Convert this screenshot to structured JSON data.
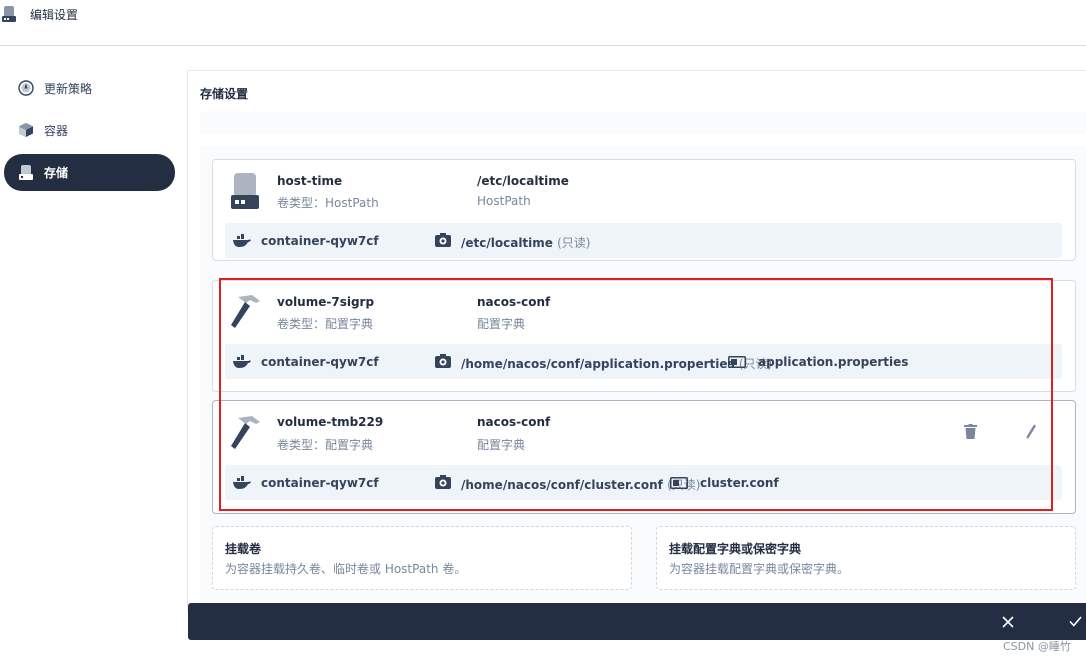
{
  "header": {
    "title": "编辑设置",
    "icon": "disk-icon"
  },
  "sidebar": {
    "items": [
      {
        "label": "更新策略",
        "icon": "update-strategy-icon",
        "active": false
      },
      {
        "label": "容器",
        "icon": "container-icon",
        "active": false
      },
      {
        "label": "存储",
        "icon": "storage-icon",
        "active": true
      }
    ]
  },
  "main": {
    "section_title": "存储设置"
  },
  "volumes": [
    {
      "name": "host-time",
      "type_label": "卷类型：HostPath",
      "source": "/etc/localtime",
      "source_type": "HostPath",
      "container": "container-qyw7cf",
      "mount_path": "/etc/localtime",
      "readonly": "(只读)",
      "sub_path": ""
    },
    {
      "name": "volume-7sigrp",
      "type_label": "卷类型：配置字典",
      "source": "nacos-conf",
      "source_type": "配置字典",
      "container": "container-qyw7cf",
      "mount_path": "/home/nacos/conf/application.properties",
      "readonly": "(只读)",
      "sub_path": "application.properties"
    },
    {
      "name": "volume-tmb229",
      "type_label": "卷类型：配置字典",
      "source": "nacos-conf",
      "source_type": "配置字典",
      "container": "container-qyw7cf",
      "mount_path": "/home/nacos/conf/cluster.conf",
      "readonly": "(只读)",
      "sub_path": "cluster.conf"
    }
  ],
  "add_options": [
    {
      "title": "挂载卷",
      "desc": "为容器挂载持久卷、临时卷或 HostPath 卷。"
    },
    {
      "title": "挂载配置字典或保密字典",
      "desc": "为容器挂载配置字典或保密字典。"
    }
  ],
  "footer": {
    "cancel_icon": "close-icon",
    "confirm_icon": "check-icon"
  },
  "watermark": "CSDN @睡竹",
  "colors": {
    "dark": "#242e42",
    "highlight": "#e02020",
    "mount_bg": "#eff4f9"
  }
}
